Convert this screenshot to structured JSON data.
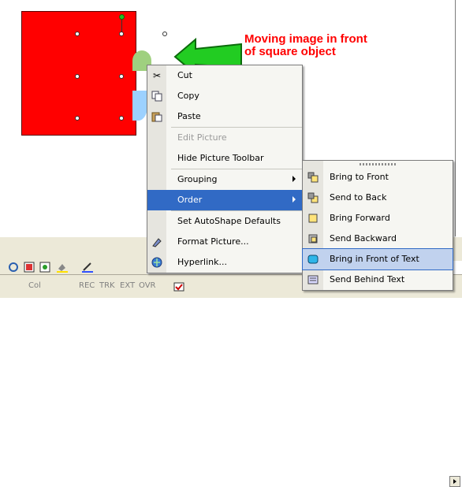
{
  "annotation": "Moving image in front\nof square object",
  "context_menu": {
    "items": [
      {
        "id": "cut",
        "label": "Cut",
        "icon": "scissors-icon",
        "disabled": false
      },
      {
        "id": "copy",
        "label": "Copy",
        "icon": "copy-icon",
        "disabled": false
      },
      {
        "id": "paste",
        "label": "Paste",
        "icon": "paste-icon",
        "disabled": false
      },
      {
        "id": "edit-picture",
        "label": "Edit Picture",
        "disabled": true
      },
      {
        "id": "hide-picture-toolbar",
        "label": "Hide Picture Toolbar",
        "disabled": false
      },
      {
        "id": "grouping",
        "label": "Grouping",
        "submenu": true
      },
      {
        "id": "order",
        "label": "Order",
        "submenu": true,
        "highlighted": true
      },
      {
        "id": "set-autoshape-defaults",
        "label": "Set AutoShape Defaults"
      },
      {
        "id": "format-picture",
        "label": "Format Picture...",
        "icon": "format-picture-icon"
      },
      {
        "id": "hyperlink",
        "label": "Hyperlink...",
        "icon": "hyperlink-icon"
      }
    ]
  },
  "order_submenu": {
    "items": [
      {
        "id": "bring-to-front",
        "label": "Bring to Front",
        "icon": "bring-to-front-icon"
      },
      {
        "id": "send-to-back",
        "label": "Send to Back",
        "icon": "send-to-back-icon"
      },
      {
        "id": "bring-forward",
        "label": "Bring Forward",
        "icon": "bring-forward-icon"
      },
      {
        "id": "send-backward",
        "label": "Send Backward",
        "icon": "send-backward-icon"
      },
      {
        "id": "bring-in-front-of-text",
        "label": "Bring in Front of Text",
        "icon": "bring-in-front-of-text-icon",
        "highlighted": true
      },
      {
        "id": "send-behind-text",
        "label": "Send Behind Text",
        "icon": "send-behind-text-icon"
      }
    ]
  },
  "statusbar": {
    "col": "Col",
    "rec": "REC",
    "trk": "TRK",
    "ext": "EXT",
    "ovr": "OVR"
  },
  "colors": {
    "square": "#ff0000",
    "annotation": "#ff0000",
    "arrow": "#22cc22",
    "menu_highlight": "#316ac5",
    "submenu_highlight": "#c1d2ee"
  }
}
